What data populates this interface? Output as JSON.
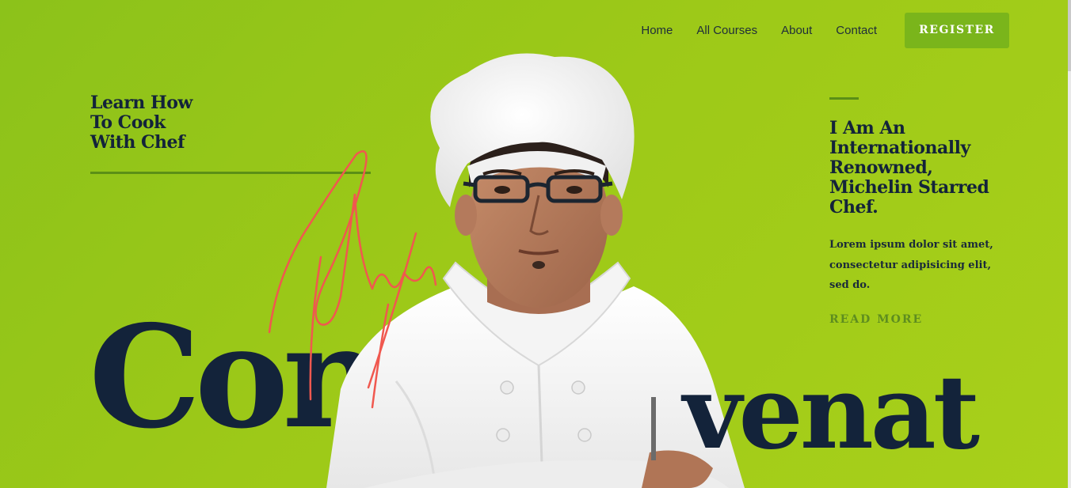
{
  "nav": {
    "items": [
      {
        "label": "Home"
      },
      {
        "label": "All Courses"
      },
      {
        "label": "About"
      },
      {
        "label": "Contact"
      }
    ],
    "register_label": "REGISTER"
  },
  "hero": {
    "left_heading": "Learn How\nTo Cook\nWith Chef",
    "right_heading": "I Am An\nInternationally\nRenowned,\nMichelin Starred\nChef.",
    "right_body": "Lorem ipsum dolor sit amet,\nconsectetur adipisicing elit,\nsed do.",
    "read_more": "READ MORE",
    "big_word_left": "Con",
    "big_word_right": "venat"
  },
  "colors": {
    "background": "#9dc918",
    "accent_button": "#7ab51b",
    "heading": "#13233a",
    "signature": "#f0584f",
    "read_more": "#5e8d1f"
  },
  "images": {
    "hero_image": "chef-portrait",
    "signature": "handwritten-signature"
  }
}
